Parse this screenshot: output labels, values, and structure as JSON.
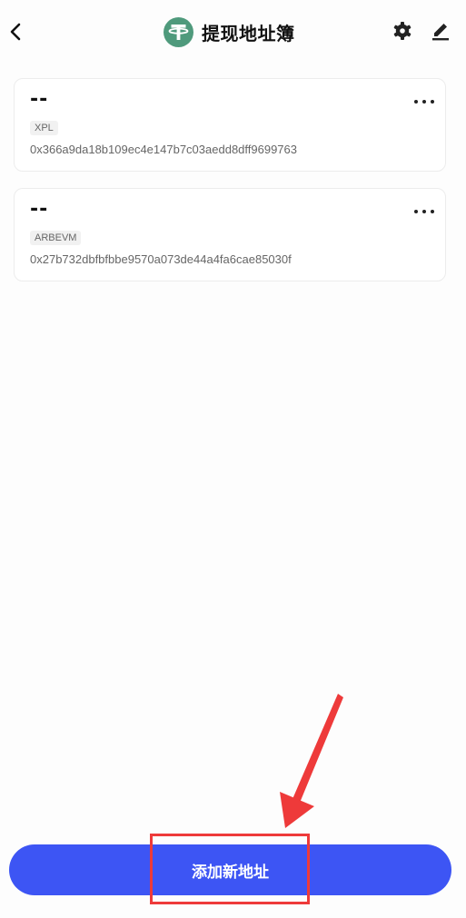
{
  "header": {
    "title": "提现地址簿",
    "back_icon": "chevron-left-icon",
    "token_icon": "tether-icon",
    "token_color": "#4f9a7c",
    "settings_icon": "gear-icon",
    "edit_icon": "pencil-icon"
  },
  "addresses": [
    {
      "name": "--",
      "network": "XPL",
      "address": "0x366a9da18b109ec4e147b7c03aedd8dff9699763",
      "more_icon": "more-icon"
    },
    {
      "name": "--",
      "network": "ARBEVM",
      "address": "0x27b732dbfbfbbe9570a073de44a4fa6cae85030f",
      "more_icon": "more-icon"
    }
  ],
  "footer": {
    "add_label": "添加新地址",
    "button_color": "#3d55f4"
  },
  "annotation": {
    "color": "#ee3a3a"
  }
}
